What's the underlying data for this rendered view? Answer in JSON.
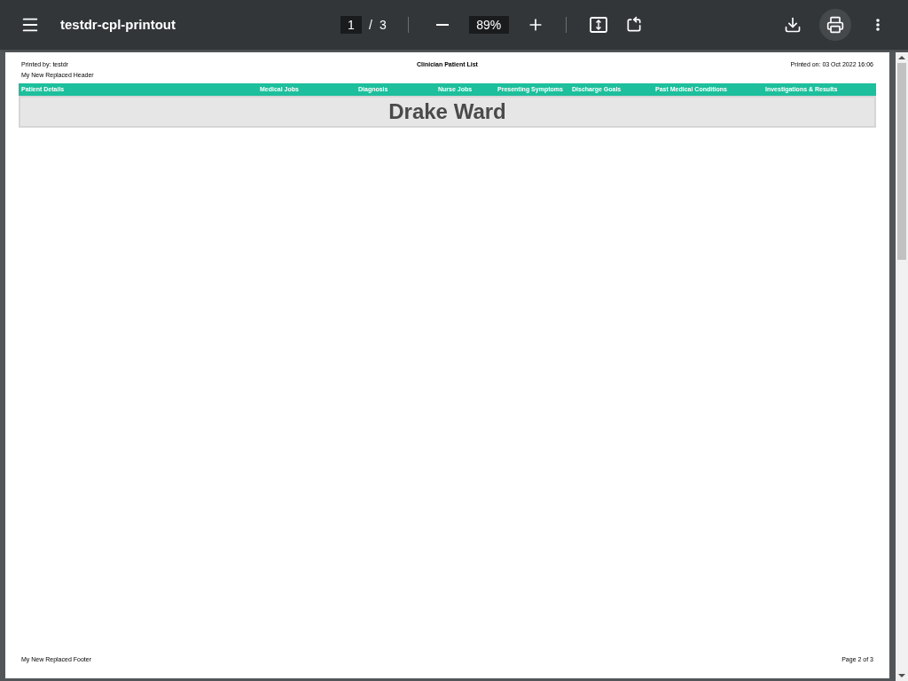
{
  "toolbar": {
    "title": "testdr-cpl-printout",
    "page_current": "1",
    "page_separator": "/",
    "page_total": "3",
    "zoom": "89%"
  },
  "page": {
    "printed_by": "Printed by: testdr",
    "header_note": "My New Replaced Header",
    "report_title": "Clinician Patient List",
    "printed_on": "Printed on: 03 Oct 2022 16:06",
    "columns": [
      "Patient Details",
      "Medical Jobs",
      "Diagnosis",
      "Nurse Jobs",
      "Presenting Symptoms",
      "Discharge Goals",
      "Past Medical Conditions",
      "Investigations & Results"
    ],
    "ward": "Drake Ward",
    "footer": "My New Replaced Footer",
    "page_number": "Page 2 of 3"
  }
}
